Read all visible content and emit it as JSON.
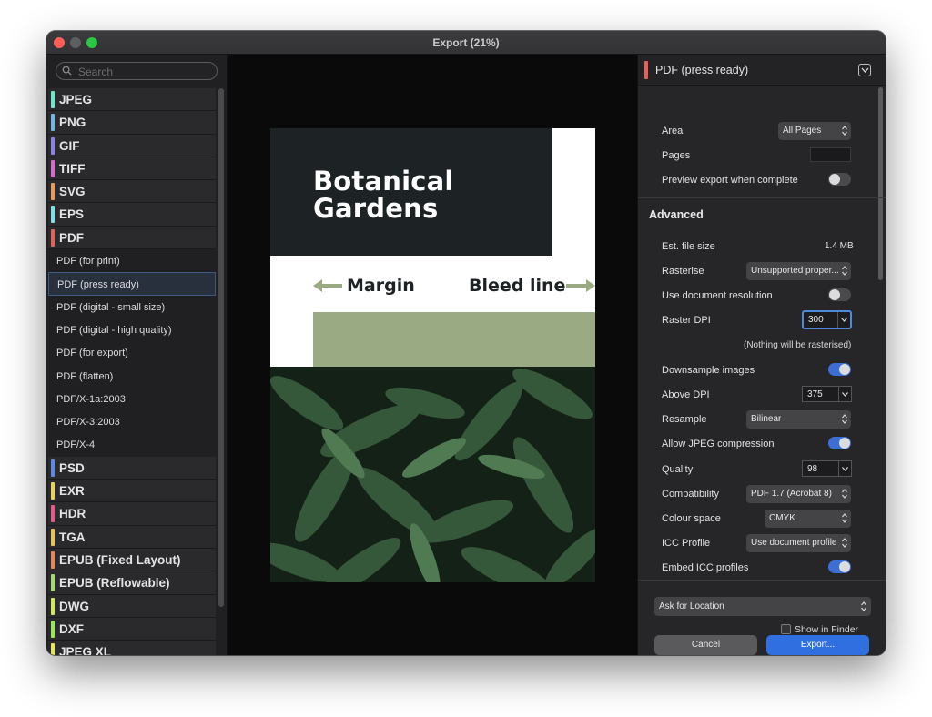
{
  "window": {
    "title": "Export (21%)"
  },
  "sidebar": {
    "search_placeholder": "Search",
    "items": [
      {
        "kind": "format",
        "label": "JPEG",
        "color": "#6ee7c8"
      },
      {
        "kind": "format",
        "label": "PNG",
        "color": "#6eb8e7"
      },
      {
        "kind": "format",
        "label": "GIF",
        "color": "#8a83e6"
      },
      {
        "kind": "format",
        "label": "TIFF",
        "color": "#d46ad0"
      },
      {
        "kind": "format",
        "label": "SVG",
        "color": "#e79a5a"
      },
      {
        "kind": "format",
        "label": "EPS",
        "color": "#7ee0e7"
      },
      {
        "kind": "format",
        "label": "PDF",
        "color": "#e0625a"
      },
      {
        "kind": "preset",
        "label": "PDF (for print)"
      },
      {
        "kind": "preset",
        "label": "PDF (press ready)",
        "selected": true
      },
      {
        "kind": "preset",
        "label": "PDF (digital - small size)"
      },
      {
        "kind": "preset",
        "label": "PDF (digital - high quality)"
      },
      {
        "kind": "preset",
        "label": "PDF (for export)"
      },
      {
        "kind": "preset",
        "label": "PDF (flatten)"
      },
      {
        "kind": "preset",
        "label": "PDF/X-1a:2003"
      },
      {
        "kind": "preset",
        "label": "PDF/X-3:2003"
      },
      {
        "kind": "preset",
        "label": "PDF/X-4"
      },
      {
        "kind": "format",
        "label": "PSD",
        "color": "#5a8ae6"
      },
      {
        "kind": "format",
        "label": "EXR",
        "color": "#e6d35a"
      },
      {
        "kind": "format",
        "label": "HDR",
        "color": "#e65a8a"
      },
      {
        "kind": "format",
        "label": "TGA",
        "color": "#e6c35a"
      },
      {
        "kind": "format",
        "label": "EPUB (Fixed Layout)",
        "color": "#e6845a"
      },
      {
        "kind": "format",
        "label": "EPUB (Reflowable)",
        "color": "#a6d86e"
      },
      {
        "kind": "format",
        "label": "DWG",
        "color": "#d4e65a"
      },
      {
        "kind": "format",
        "label": "DXF",
        "color": "#9ae65a"
      },
      {
        "kind": "format",
        "label": "JPEG XL",
        "color": "#e6e65a"
      }
    ]
  },
  "preview": {
    "title": "Botanical Gardens",
    "margin_label": "Margin",
    "bleed_label": "Bleed line",
    "colors": {
      "dark": "#1d2225",
      "green": "#9aab83",
      "leaf": "#2f5130"
    }
  },
  "panel": {
    "header_title": "PDF (press ready)",
    "area_label": "Area",
    "area_value": "All Pages",
    "pages_label": "Pages",
    "preview_label": "Preview export when complete",
    "preview_on": false,
    "advanced_title": "Advanced",
    "filesize_label": "Est. file size",
    "filesize_value": "1.4 MB",
    "rasterise_label": "Rasterise",
    "rasterise_value": "Unsupported proper...",
    "docres_label": "Use document resolution",
    "docres_on": false,
    "rasterdpi_label": "Raster DPI",
    "rasterdpi_value": "300",
    "raster_note": "(Nothing will be rasterised)",
    "downsample_label": "Downsample images",
    "downsample_on": true,
    "abovedpi_label": "Above DPI",
    "abovedpi_value": "375",
    "resample_label": "Resample",
    "resample_value": "Bilinear",
    "jpeg_label": "Allow JPEG compression",
    "jpeg_on": true,
    "quality_label": "Quality",
    "quality_value": "98",
    "compat_label": "Compatibility",
    "compat_value": "PDF 1.7 (Acrobat 8)",
    "colour_label": "Colour space",
    "colour_value": "CMYK",
    "icc_label": "ICC Profile",
    "icc_value": "Use document profile",
    "embed_label": "Embed ICC profiles",
    "embed_on": true,
    "location_value": "Ask for Location",
    "finder_label": "Show in Finder",
    "cancel_label": "Cancel",
    "export_label": "Export..."
  }
}
